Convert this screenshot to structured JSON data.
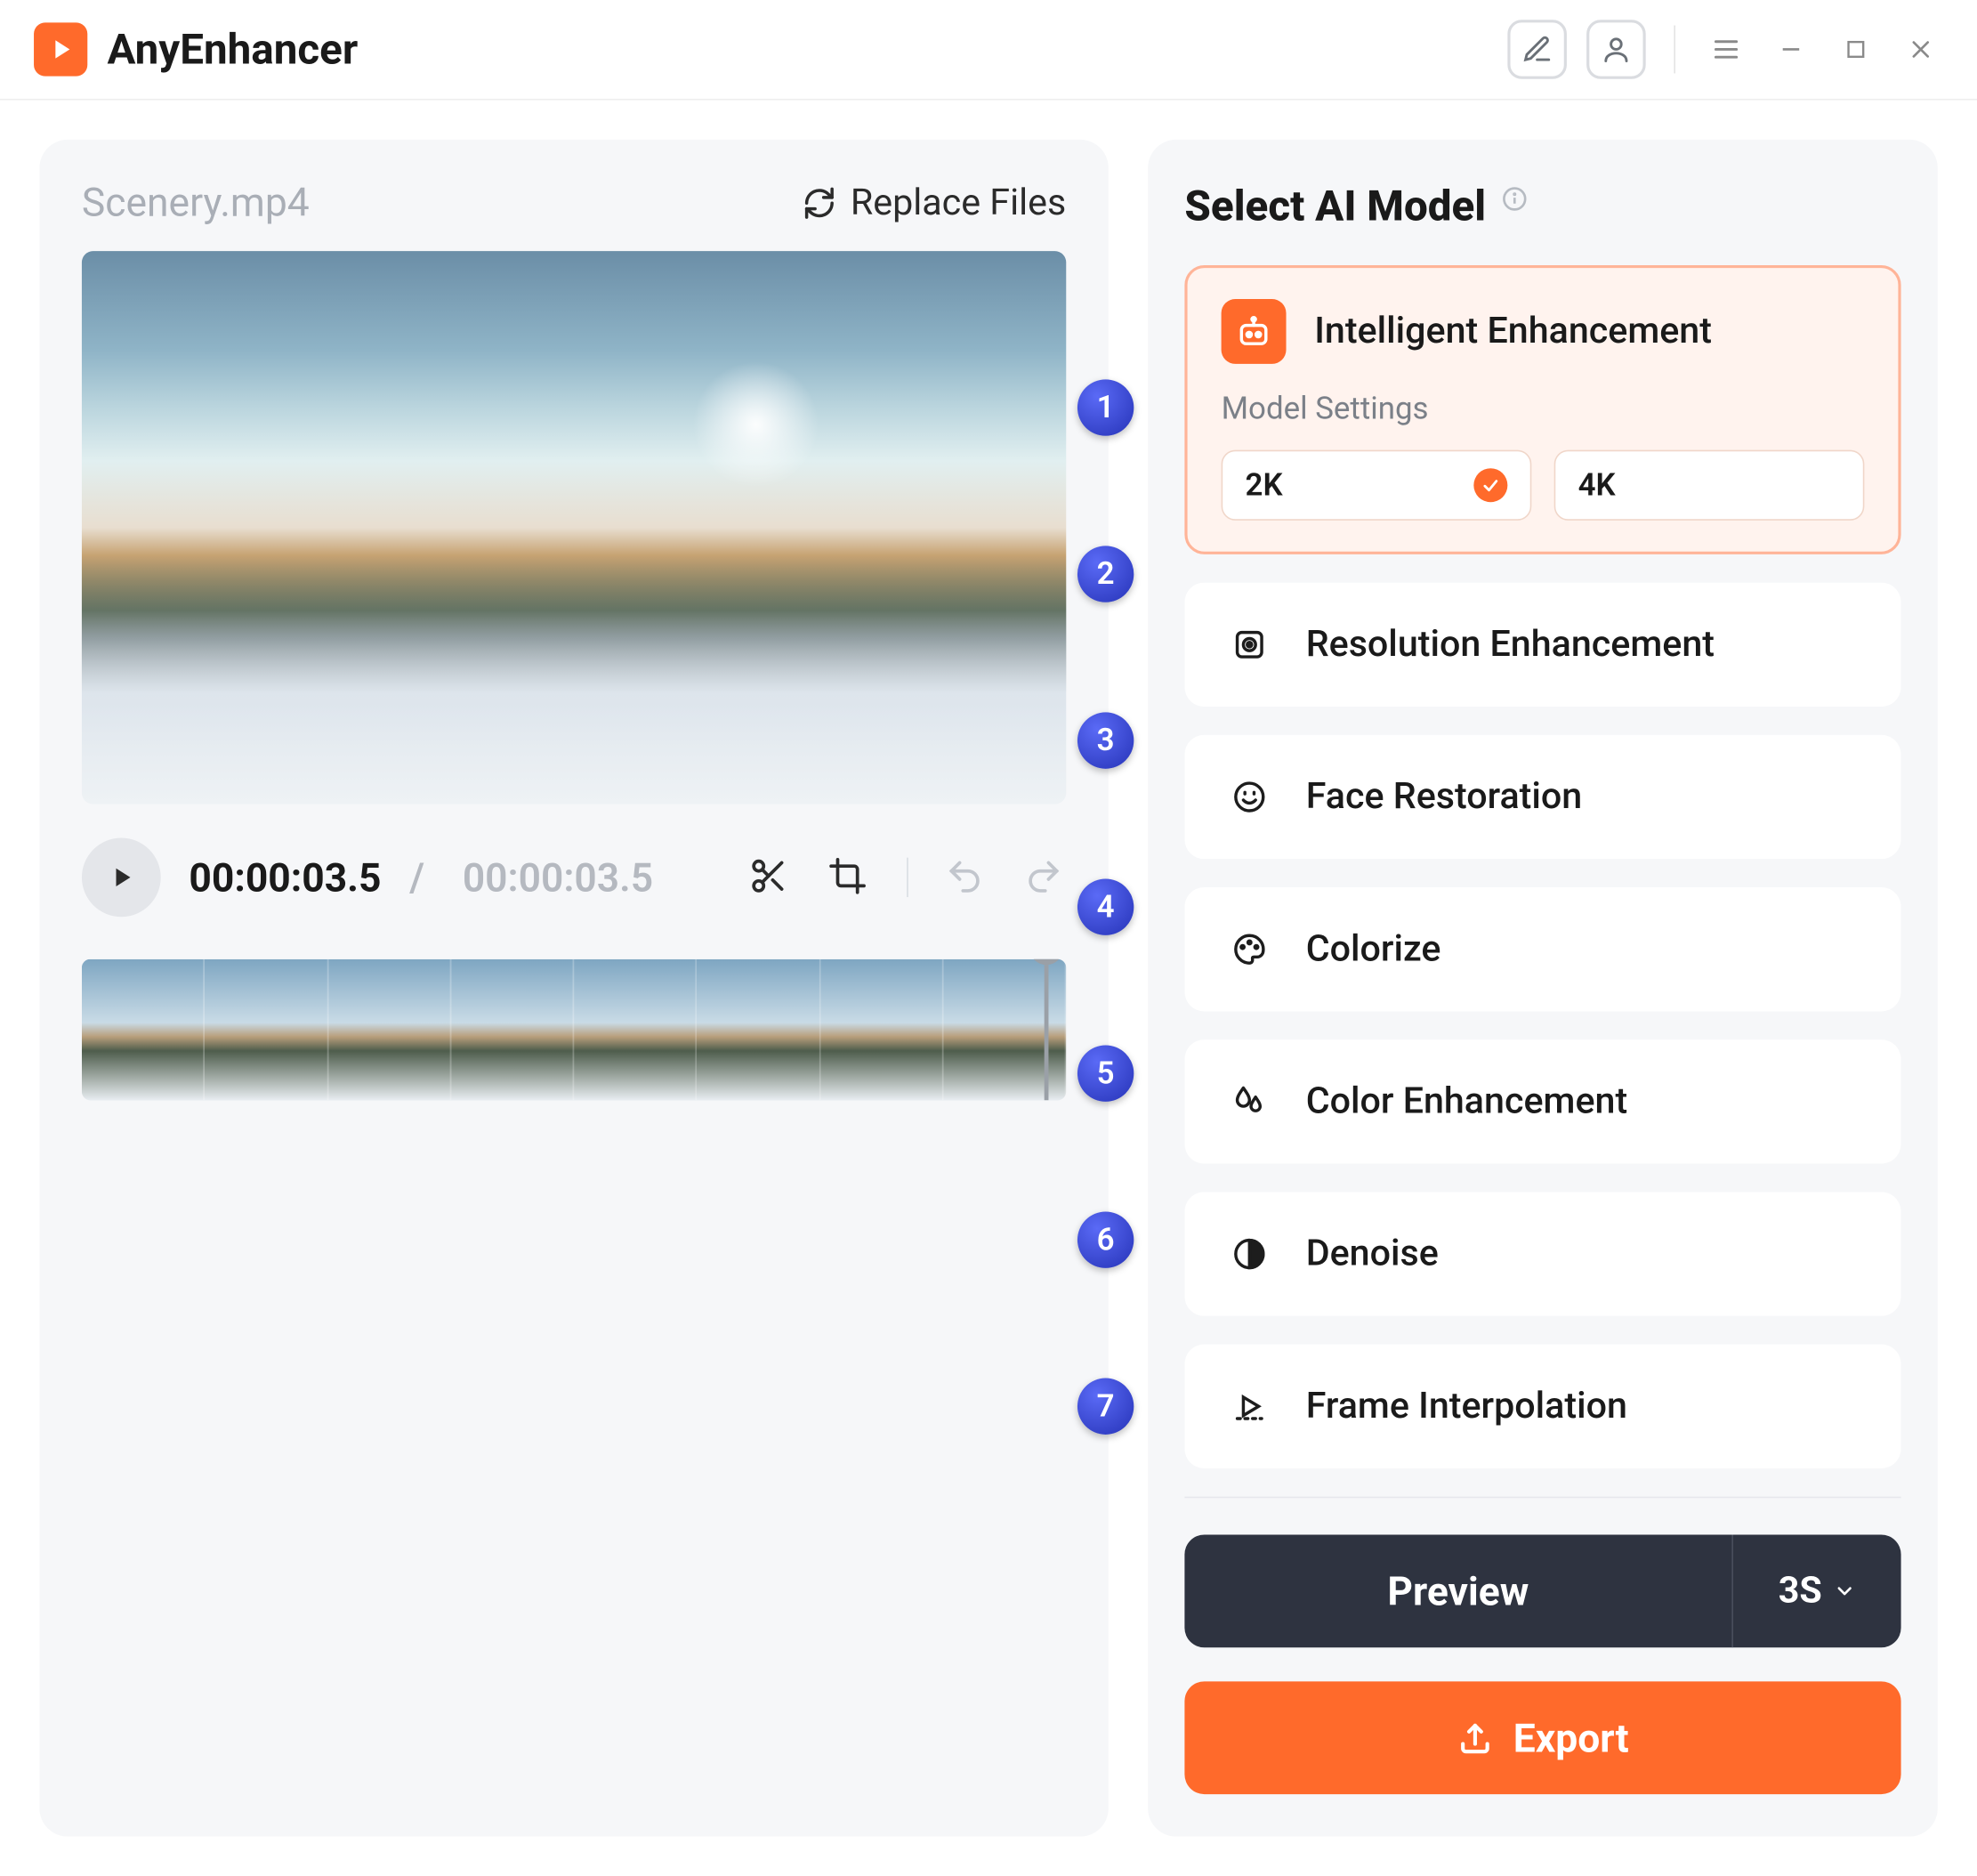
{
  "app": {
    "name": "AnyEnhancer"
  },
  "file": {
    "name": "Scenery.mp4",
    "replace_label": "Replace Files"
  },
  "playback": {
    "current": "00:00:03.5",
    "total": "00:00:03.5"
  },
  "steps": [
    "1",
    "2",
    "3",
    "4",
    "5",
    "6",
    "7"
  ],
  "sidebar": {
    "title": "Select AI Model",
    "models": [
      {
        "id": "intelligent",
        "label": "Intelligent Enhancement",
        "settings_label": "Model Settings",
        "options": [
          {
            "label": "2K",
            "selected": true
          },
          {
            "label": "4K",
            "selected": false
          }
        ]
      },
      {
        "id": "resolution",
        "label": "Resolution Enhancement"
      },
      {
        "id": "face",
        "label": "Face Restoration"
      },
      {
        "id": "colorize",
        "label": "Colorize"
      },
      {
        "id": "colorenh",
        "label": "Color Enhancement"
      },
      {
        "id": "denoise",
        "label": "Denoise"
      },
      {
        "id": "frame",
        "label": "Frame Interpolation"
      }
    ]
  },
  "actions": {
    "preview_label": "Preview",
    "preview_duration": "3S",
    "export_label": "Export"
  }
}
